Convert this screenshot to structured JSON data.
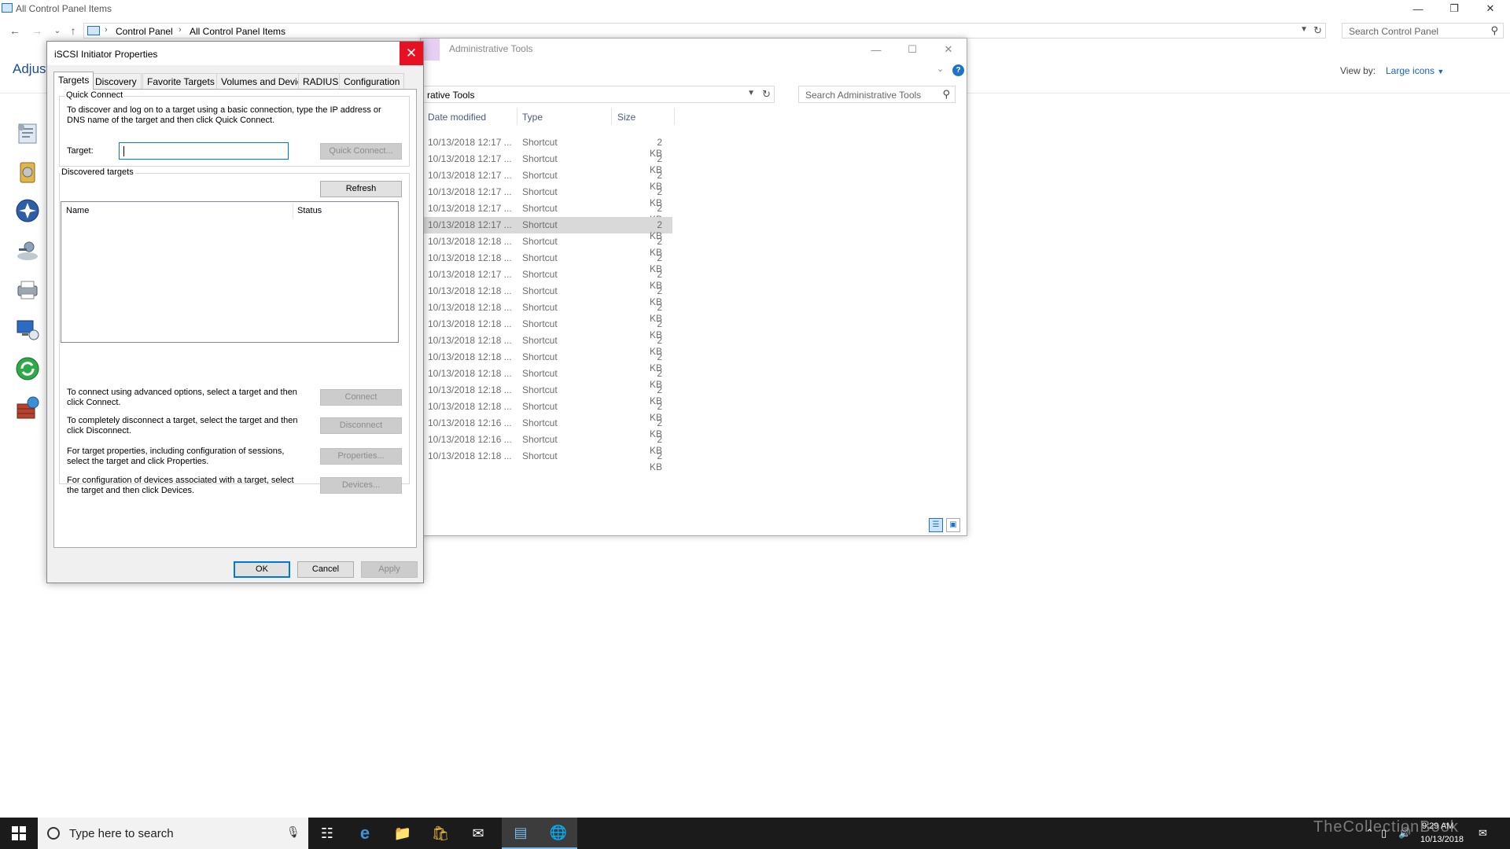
{
  "control_panel": {
    "window_title": "All Control Panel Items",
    "breadcrumb": [
      "Control Panel",
      "All Control Panel Items"
    ],
    "search_placeholder": "Search Control Panel",
    "heading_partial": "Adjust",
    "view_by_label": "View by:",
    "view_by_value": "Large icons"
  },
  "admin_tools": {
    "title": "Administrative Tools",
    "address_partial": "rative Tools",
    "search_placeholder": "Search Administrative Tools",
    "columns": [
      "Date modified",
      "Type",
      "Size"
    ],
    "rows": [
      {
        "date": "10/13/2018 12:17 ...",
        "type": "Shortcut",
        "size": "2 KB",
        "selected": false
      },
      {
        "date": "10/13/2018 12:17 ...",
        "type": "Shortcut",
        "size": "2 KB",
        "selected": false
      },
      {
        "date": "10/13/2018 12:17 ...",
        "type": "Shortcut",
        "size": "2 KB",
        "selected": false
      },
      {
        "date": "10/13/2018 12:17 ...",
        "type": "Shortcut",
        "size": "2 KB",
        "selected": false
      },
      {
        "date": "10/13/2018 12:17 ...",
        "type": "Shortcut",
        "size": "2 KB",
        "selected": false
      },
      {
        "date": "10/13/2018 12:17 ...",
        "type": "Shortcut",
        "size": "2 KB",
        "selected": true
      },
      {
        "date": "10/13/2018 12:18 ...",
        "type": "Shortcut",
        "size": "2 KB",
        "selected": false
      },
      {
        "date": "10/13/2018 12:18 ...",
        "type": "Shortcut",
        "size": "2 KB",
        "selected": false
      },
      {
        "date": "10/13/2018 12:17 ...",
        "type": "Shortcut",
        "size": "2 KB",
        "selected": false
      },
      {
        "date": "10/13/2018 12:18 ...",
        "type": "Shortcut",
        "size": "2 KB",
        "selected": false
      },
      {
        "date": "10/13/2018 12:18 ...",
        "type": "Shortcut",
        "size": "2 KB",
        "selected": false
      },
      {
        "date": "10/13/2018 12:18 ...",
        "type": "Shortcut",
        "size": "2 KB",
        "selected": false
      },
      {
        "date": "10/13/2018 12:18 ...",
        "type": "Shortcut",
        "size": "2 KB",
        "selected": false
      },
      {
        "date": "10/13/2018 12:18 ...",
        "type": "Shortcut",
        "size": "2 KB",
        "selected": false
      },
      {
        "date": "10/13/2018 12:18 ...",
        "type": "Shortcut",
        "size": "2 KB",
        "selected": false
      },
      {
        "date": "10/13/2018 12:18 ...",
        "type": "Shortcut",
        "size": "2 KB",
        "selected": false
      },
      {
        "date": "10/13/2018 12:18 ...",
        "type": "Shortcut",
        "size": "2 KB",
        "selected": false
      },
      {
        "date": "10/13/2018 12:16 ...",
        "type": "Shortcut",
        "size": "2 KB",
        "selected": false
      },
      {
        "date": "10/13/2018 12:16 ...",
        "type": "Shortcut",
        "size": "2 KB",
        "selected": false
      },
      {
        "date": "10/13/2018 12:18 ...",
        "type": "Shortcut",
        "size": "2 KB",
        "selected": false
      }
    ]
  },
  "iscsi": {
    "title": "iSCSI Initiator Properties",
    "close_glyph": "✕",
    "tabs": [
      "Targets",
      "Discovery",
      "Favorite Targets",
      "Volumes and Devices",
      "RADIUS",
      "Configuration"
    ],
    "quick_connect": {
      "group_label": "Quick Connect",
      "description": "To discover and log on to a target using a basic connection, type the IP address or DNS name of the target and then click Quick Connect.",
      "target_label": "Target:",
      "target_value": "",
      "button": "Quick Connect..."
    },
    "discovered": {
      "group_label": "Discovered targets",
      "refresh_button": "Refresh",
      "columns": [
        "Name",
        "Status"
      ],
      "connect_text": "To connect using advanced options, select a target and then click Connect.",
      "connect_button": "Connect",
      "disconnect_text": "To completely disconnect a target, select the target and then click Disconnect.",
      "disconnect_button": "Disconnect",
      "properties_text": "For target properties, including configuration of sessions, select the target and click Properties.",
      "properties_button": "Properties...",
      "devices_text": "For configuration of devices associated with a target, select the target and then click Devices.",
      "devices_button": "Devices..."
    },
    "buttons": {
      "ok": "OK",
      "cancel": "Cancel",
      "apply": "Apply"
    }
  },
  "taskbar": {
    "search_placeholder": "Type here to search",
    "time": "9:29 AM",
    "date": "10/13/2018",
    "watermark": "TheCollectionBook"
  },
  "colors": {
    "accent": "#0078d7",
    "close_red": "#e81123",
    "taskbar": "#1b1b1b"
  }
}
